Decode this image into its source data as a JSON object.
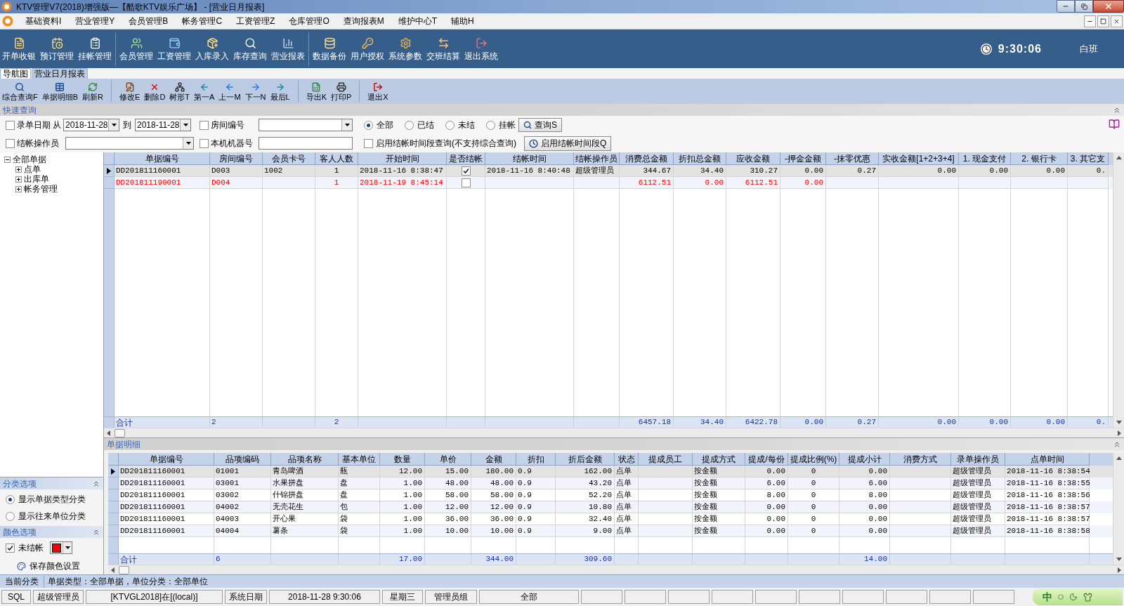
{
  "window": {
    "title": "KTV管理V7(2018)增强版—【酷歌KTV娱乐广场】 - [营业日月报表]"
  },
  "menu": [
    "基础资料I",
    "营业管理Y",
    "会员管理B",
    "帐务管理C",
    "工资管理Z",
    "仓库管理O",
    "查询报表M",
    "维护中心T",
    "辅助H"
  ],
  "toolbar": {
    "groups": [
      [
        "开单收银",
        "预订管理",
        "挂帐管理"
      ],
      [
        "会员管理",
        "工资管理",
        "入库录入",
        "库存查询",
        "营业报表"
      ],
      [
        "数据备份",
        "用户授权",
        "系统参数",
        "交班结算",
        "退出系统"
      ]
    ],
    "clock": "9:30:06",
    "shift": "白班"
  },
  "tabs": [
    {
      "label": "导航图",
      "selected": false
    },
    {
      "label": "营业日月报表",
      "selected": true
    }
  ],
  "actions": [
    [
      "综合查询F",
      "单据明细B",
      "刷新R"
    ],
    [
      "修改E",
      "删除D",
      "树形T",
      "第一A",
      "上一M",
      "下一N",
      "最后L"
    ],
    [
      "导出K",
      "打印P"
    ],
    [
      "退出X"
    ]
  ],
  "quick_search": {
    "title": "快速查询",
    "date_filter": {
      "label": "录单日期",
      "checked": false,
      "from_label": "从",
      "from": "2018-11-28",
      "to_label": "到",
      "to": "2018-11-28"
    },
    "room": {
      "label": "房间编号",
      "checked": false
    },
    "status_options": [
      {
        "label": "全部",
        "selected": true
      },
      {
        "label": "已结",
        "selected": false
      },
      {
        "label": "未结",
        "selected": false
      },
      {
        "label": "挂帐",
        "selected": false
      }
    ],
    "query_button": "查询S",
    "operator": {
      "label": "结帐操作员",
      "checked": false
    },
    "machine": {
      "label": "本机机器号",
      "checked": false
    },
    "time_range": {
      "label": "启用结帐时间段查询(不支持综合查询)",
      "checked": false
    },
    "time_range_button": "启用结帐时间段Q"
  },
  "tree": {
    "label": "全部单据",
    "expanded": true,
    "children": [
      {
        "label": "点单",
        "expanded": false
      },
      {
        "label": "出库单",
        "expanded": false
      },
      {
        "label": "帐务管理",
        "expanded": false
      }
    ]
  },
  "category_options": {
    "title": "分类选项",
    "options": [
      {
        "label": "显示单据类型分类",
        "selected": true
      },
      {
        "label": "显示往来单位分类",
        "selected": false
      }
    ]
  },
  "color_options": {
    "title": "颜色选项",
    "unsettled": {
      "label": "未结帐",
      "checked": true,
      "color": "#ff0000"
    },
    "save_button": "保存颜色设置"
  },
  "orders": {
    "columns": [
      {
        "label": "单据编号",
        "kind": "text",
        "total": "合计"
      },
      {
        "label": "房间编号",
        "kind": "text",
        "total": "2"
      },
      {
        "label": "会员卡号",
        "kind": "text"
      },
      {
        "label": "客人人数",
        "kind": "count",
        "total": "2"
      },
      {
        "label": "开始时间",
        "kind": "text"
      },
      {
        "label": "是否结帐",
        "kind": "check"
      },
      {
        "label": "结帐时间",
        "kind": "text"
      },
      {
        "label": "结帐操作员",
        "kind": "text"
      },
      {
        "label": "消费总金额",
        "kind": "number",
        "total": "6457.18"
      },
      {
        "label": "折扣总金额",
        "kind": "number",
        "total": "34.40"
      },
      {
        "label": "应收金额",
        "kind": "number",
        "total": "6422.78"
      },
      {
        "label": "-押金金额",
        "kind": "number",
        "total": "0.00"
      },
      {
        "label": "-抹零优惠",
        "kind": "number",
        "total": "0.27"
      },
      {
        "label": "实收金额[1+2+3+4]",
        "kind": "number",
        "total": "0.00"
      },
      {
        "label": "1. 现金支付",
        "kind": "number",
        "total": "0.00"
      },
      {
        "label": "2. 银行卡",
        "kind": "number",
        "total": "0.00"
      },
      {
        "label": "3. 其它支",
        "kind": "number",
        "total": "0."
      }
    ],
    "rows": [
      {
        "selected": true,
        "settled": true,
        "order_no": "DD201811160001",
        "room": "D003",
        "card": "1002",
        "guests": "1",
        "start": "2018-11-16 8:38:47",
        "end": "2018-11-16 8:40:48",
        "operator": "超级管理员",
        "total": "344.67",
        "discount": "34.40",
        "receivable": "310.27",
        "deposit": "0.00",
        "rounding": "0.27",
        "received": "0.00",
        "cash": "0.00",
        "bank_card": "0.00",
        "other": "0."
      },
      {
        "selected": false,
        "settled": false,
        "order_no": "DD201811190001",
        "room": "D004",
        "guests": "1",
        "start": "2018-11-19 8:45:14",
        "total": "6112.51",
        "discount": "0.00",
        "receivable": "6112.51",
        "deposit": "0.00"
      }
    ]
  },
  "detail": {
    "title": "单据明细",
    "columns": [
      {
        "label": "单据编号",
        "kind": "text",
        "total": "合计"
      },
      {
        "label": "品项编码",
        "kind": "text",
        "total": "6"
      },
      {
        "label": "品项名称",
        "kind": "text"
      },
      {
        "label": "基本单位",
        "kind": "text"
      },
      {
        "label": "数量",
        "kind": "number",
        "total": "17.00"
      },
      {
        "label": "单价",
        "kind": "number"
      },
      {
        "label": "金额",
        "kind": "number",
        "total": "344.00"
      },
      {
        "label": "折扣",
        "kind": "text"
      },
      {
        "label": "折后金额",
        "kind": "number",
        "total": "309.60"
      },
      {
        "label": "状态",
        "kind": "text"
      },
      {
        "label": "提成员工",
        "kind": "text"
      },
      {
        "label": "提成方式",
        "kind": "text"
      },
      {
        "label": "提成/每份",
        "kind": "number"
      },
      {
        "label": "提成比例(%)",
        "kind": "count"
      },
      {
        "label": "提成小计",
        "kind": "number",
        "total": "14.00"
      },
      {
        "label": "消费方式",
        "kind": "text"
      },
      {
        "label": "录单操作员",
        "kind": "text"
      },
      {
        "label": "点单时间",
        "kind": "text"
      }
    ],
    "rows": [
      {
        "selected": true,
        "order_no": "DD201811160001",
        "item_code": "01001",
        "item_name": "青岛啤酒",
        "unit": "瓶",
        "qty": "12.00",
        "price": "15.00",
        "amount": "180.00",
        "rate": "0.9",
        "net": "162.00",
        "status": "点单",
        "mode": "按金额",
        "each": "0.00",
        "pct": "0",
        "subtotal": "0.00",
        "clerk": "超级管理员",
        "time": "2018-11-16 8:38:54"
      },
      {
        "selected": false,
        "order_no": "DD201811160001",
        "item_code": "03001",
        "item_name": "水果拼盘",
        "unit": "盘",
        "qty": "1.00",
        "price": "48.00",
        "amount": "48.00",
        "rate": "0.9",
        "net": "43.20",
        "status": "点单",
        "mode": "按金额",
        "each": "6.00",
        "pct": "0",
        "subtotal": "6.00",
        "clerk": "超级管理员",
        "time": "2018-11-16 8:38:55"
      },
      {
        "selected": false,
        "order_no": "DD201811160001",
        "item_code": "03002",
        "item_name": "什锦拼盘",
        "unit": "盘",
        "qty": "1.00",
        "price": "58.00",
        "amount": "58.00",
        "rate": "0.9",
        "net": "52.20",
        "status": "点单",
        "mode": "按金额",
        "each": "8.00",
        "pct": "0",
        "subtotal": "8.00",
        "clerk": "超级管理员",
        "time": "2018-11-16 8:38:56"
      },
      {
        "selected": false,
        "order_no": "DD201811160001",
        "item_code": "04002",
        "item_name": "无壳花生",
        "unit": "包",
        "qty": "1.00",
        "price": "12.00",
        "amount": "12.00",
        "rate": "0.9",
        "net": "10.80",
        "status": "点单",
        "mode": "按金额",
        "each": "0.00",
        "pct": "0",
        "subtotal": "0.00",
        "clerk": "超级管理员",
        "time": "2018-11-16 8:38:57"
      },
      {
        "selected": false,
        "order_no": "DD201811160001",
        "item_code": "04003",
        "item_name": "开心果",
        "unit": "袋",
        "qty": "1.00",
        "price": "36.00",
        "amount": "36.00",
        "rate": "0.9",
        "net": "32.40",
        "status": "点单",
        "mode": "按金额",
        "each": "0.00",
        "pct": "0",
        "subtotal": "0.00",
        "clerk": "超级管理员",
        "time": "2018-11-16 8:38:57"
      },
      {
        "selected": false,
        "order_no": "DD201811160001",
        "item_code": "04004",
        "item_name": "薯条",
        "unit": "袋",
        "qty": "1.00",
        "price": "10.00",
        "amount": "10.00",
        "rate": "0.9",
        "net": "9.00",
        "status": "点单",
        "mode": "按金额",
        "each": "0.00",
        "pct": "0",
        "subtotal": "0.00",
        "clerk": "超级管理员",
        "time": "2018-11-16 8:38:58"
      }
    ]
  },
  "status_bar": {
    "category_label": "当前分类",
    "category": "单据类型：全部单据，单位分类：全部单位",
    "cells": [
      "SQL",
      "超级管理员",
      "[KTVGL2018]在[(local)]",
      "系统日期",
      "2018-11-28  9:30:06",
      "星期三",
      "管理员组",
      "全部"
    ],
    "ime": "中"
  }
}
